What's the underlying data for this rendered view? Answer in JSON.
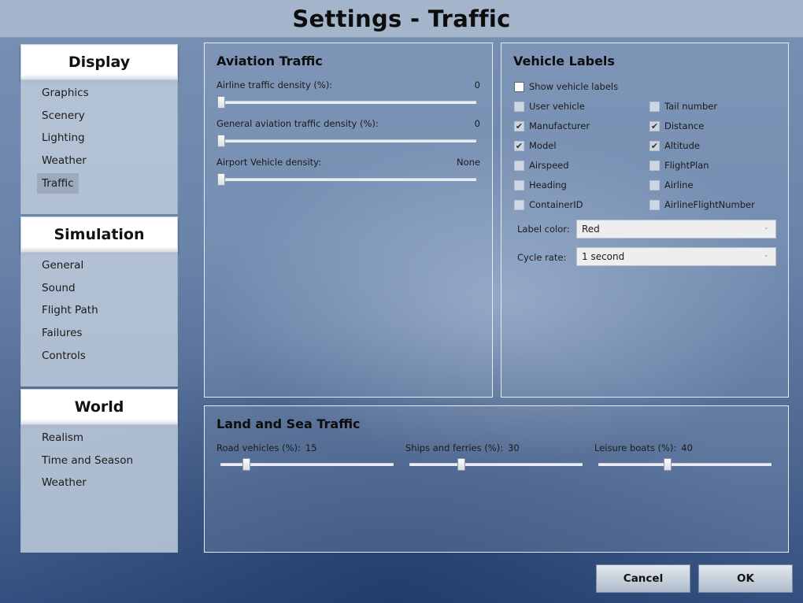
{
  "title": "Settings - Traffic",
  "sidebar": {
    "sections": [
      {
        "header": "Display",
        "items": [
          "Graphics",
          "Scenery",
          "Lighting",
          "Weather",
          "Traffic"
        ]
      },
      {
        "header": "Simulation",
        "items": [
          "General",
          "Sound",
          "Flight Path",
          "Failures",
          "Controls"
        ]
      },
      {
        "header": "World",
        "items": [
          "Realism",
          "Time and Season",
          "Weather"
        ]
      }
    ],
    "active_item": "Traffic"
  },
  "aviation": {
    "title": "Aviation Traffic",
    "sliders": [
      {
        "label": "Airline traffic density (%):",
        "value": "0",
        "fraction": 0
      },
      {
        "label": "General aviation traffic density (%):",
        "value": "0",
        "fraction": 0
      },
      {
        "label": "Airport Vehicle density:",
        "value": "None",
        "fraction": 0
      }
    ]
  },
  "vehicle_labels": {
    "title": "Vehicle Labels",
    "show_label": "Show vehicle labels",
    "show_checked": false,
    "options": [
      {
        "label": "User vehicle",
        "checked": false
      },
      {
        "label": "Tail number",
        "checked": false
      },
      {
        "label": "Manufacturer",
        "checked": true
      },
      {
        "label": "Distance",
        "checked": true
      },
      {
        "label": "Model",
        "checked": true
      },
      {
        "label": "Altitude",
        "checked": true
      },
      {
        "label": "Airspeed",
        "checked": false
      },
      {
        "label": "FlightPlan",
        "checked": false
      },
      {
        "label": "Heading",
        "checked": false
      },
      {
        "label": "Airline",
        "checked": false
      },
      {
        "label": "ContainerID",
        "checked": false
      },
      {
        "label": "AirlineFlightNumber",
        "checked": false
      }
    ],
    "label_color_label": "Label color:",
    "label_color_value": "Red",
    "cycle_rate_label": "Cycle rate:",
    "cycle_rate_value": "1 second"
  },
  "land_sea": {
    "title": "Land and Sea Traffic",
    "sliders": [
      {
        "label": "Road vehicles (%):",
        "value": "15",
        "fraction": 0.15
      },
      {
        "label": "Ships and ferries (%):",
        "value": "30",
        "fraction": 0.3
      },
      {
        "label": "Leisure boats (%):",
        "value": "40",
        "fraction": 0.4
      }
    ]
  },
  "buttons": {
    "cancel": "Cancel",
    "ok": "OK"
  },
  "icons": {
    "check": "check-icon",
    "dropdown": "chevron-down-icon"
  }
}
